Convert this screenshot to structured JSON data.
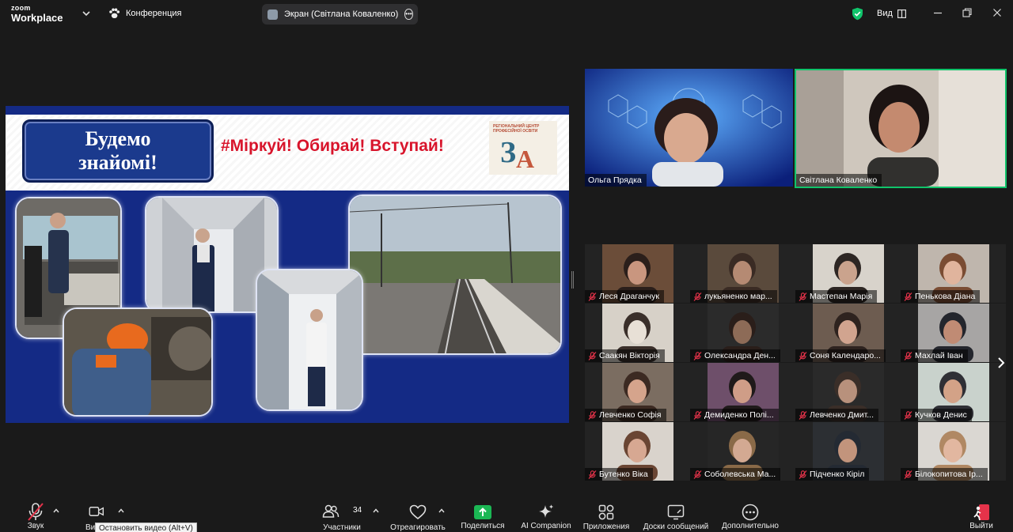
{
  "topbar": {
    "brand_small": "zoom",
    "brand_large": "Workplace",
    "meeting_label": "Конференция",
    "share_label": "Экран (Світлана Коваленко)",
    "view_label": "Вид"
  },
  "slide": {
    "hello_line1": "Будемо",
    "hello_line2": "знайомі!",
    "hashtag": "#Міркуй! Обирай! Вступай!",
    "logo_text": "РЕГІОНАЛЬНИЙ ЦЕНТР ПРОФЕСІЙНОЇ ОСВІТИ",
    "logo_letters": "ЗА"
  },
  "speakers": [
    {
      "name": "Ольга Прядка"
    },
    {
      "name": "Світлана Коваленко"
    }
  ],
  "participants": [
    {
      "name": "Леся Драганчук"
    },
    {
      "name": "лукьяненко мар..."
    },
    {
      "name": "Мастепан Марія"
    },
    {
      "name": "Пенькова Діана"
    },
    {
      "name": "Саакян Вікторія"
    },
    {
      "name": "Олександра Ден..."
    },
    {
      "name": "Соня Календаро..."
    },
    {
      "name": "Махлай Іван"
    },
    {
      "name": "Левченко Софія"
    },
    {
      "name": "Демиденко Полі..."
    },
    {
      "name": "Левченко Дмит..."
    },
    {
      "name": "Кучков Денис"
    },
    {
      "name": "Бутенко Віка"
    },
    {
      "name": "Соболевська Ма..."
    },
    {
      "name": "Підченко Кіріл"
    },
    {
      "name": "Білокопитова Ір..."
    }
  ],
  "toolbar": {
    "audio": "Звук",
    "video": "Ви",
    "participants": "Участники",
    "participants_count": "34",
    "react": "Отреагировать",
    "share": "Поделиться",
    "ai": "AI Companion",
    "apps": "Приложения",
    "whiteboards": "Доски сообщений",
    "more": "Дополнительно",
    "leave": "Выйти"
  },
  "tooltip": "Остановить видео (Alt+V)",
  "colors": {
    "accent_green": "#10c46b",
    "share_green": "#1bb754",
    "mute_red": "#e5334a",
    "leave_red": "#e5334a",
    "slide_blue": "#142a85"
  }
}
